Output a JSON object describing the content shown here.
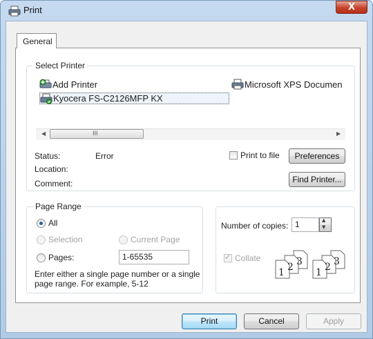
{
  "window": {
    "title": "Print",
    "close_glyph": "X"
  },
  "tabs": [
    {
      "label": "General"
    }
  ],
  "select_printer": {
    "legend": "Select Printer",
    "printers": [
      {
        "label": "Add Printer",
        "icon": "add-printer-icon"
      },
      {
        "label": "Microsoft XPS Documen",
        "icon": "printer-icon"
      },
      {
        "label": "Kyocera FS-C2126MFP KX",
        "icon": "default-printer-icon",
        "selected": true
      }
    ],
    "scroll_thumb_glyph": "III",
    "status_label": "Status:",
    "status_value": "Error",
    "location_label": "Location:",
    "comment_label": "Comment:",
    "print_to_file": "Print to file",
    "preferences": "Preferences",
    "find_printer": "Find Printer..."
  },
  "page_range": {
    "legend": "Page Range",
    "all": "All",
    "selection": "Selection",
    "current_page": "Current Page",
    "pages": "Pages:",
    "pages_value": "1-65535",
    "hint": "Enter either a single page number or a single page range.  For example, 5-12"
  },
  "copies": {
    "label": "Number of copies:",
    "value": "1",
    "collate": "Collate",
    "collate_pages": [
      "1",
      "2",
      "3"
    ]
  },
  "buttons": {
    "print": "Print",
    "cancel": "Cancel",
    "apply": "Apply"
  }
}
